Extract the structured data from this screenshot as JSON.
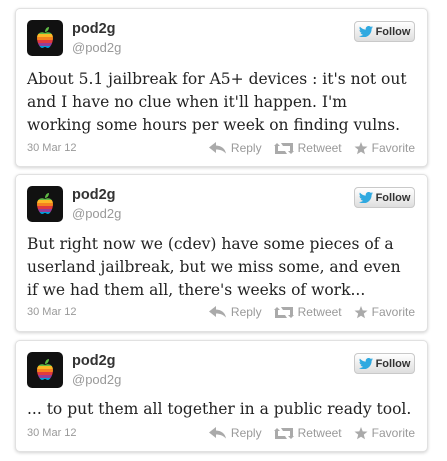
{
  "tweets": [
    {
      "name": "pod2g",
      "handle": "@pod2g",
      "follow_label": "Follow",
      "text": "About 5.1 jailbreak for A5+ devices : it's not out and I have no clue when it'll happen. I'm working some hours per week on finding vulns.",
      "date": "30 Mar 12",
      "reply_label": "Reply",
      "retweet_label": "Retweet",
      "favorite_label": "Favorite"
    },
    {
      "name": "pod2g",
      "handle": "@pod2g",
      "follow_label": "Follow",
      "text": "But right now we (cdev) have some pieces of a userland jailbreak, but we miss some, and even if we had them all, there's weeks of work...",
      "date": "30 Mar 12",
      "reply_label": "Reply",
      "retweet_label": "Retweet",
      "favorite_label": "Favorite"
    },
    {
      "name": "pod2g",
      "handle": "@pod2g",
      "follow_label": "Follow",
      "text": "... to put them all together in a public ready tool.",
      "date": "30 Mar 12",
      "reply_label": "Reply",
      "retweet_label": "Retweet",
      "favorite_label": "Favorite"
    }
  ],
  "icons": {
    "avatar": "apple-logo-icon",
    "bird": "twitter-bird-icon",
    "reply": "reply-arrow-icon",
    "retweet": "retweet-icon",
    "favorite": "star-icon"
  },
  "colors": {
    "bird_blue": "#2fa9e0",
    "meta_gray": "#999999",
    "text_dark": "#222222",
    "name_dark": "#333333"
  }
}
